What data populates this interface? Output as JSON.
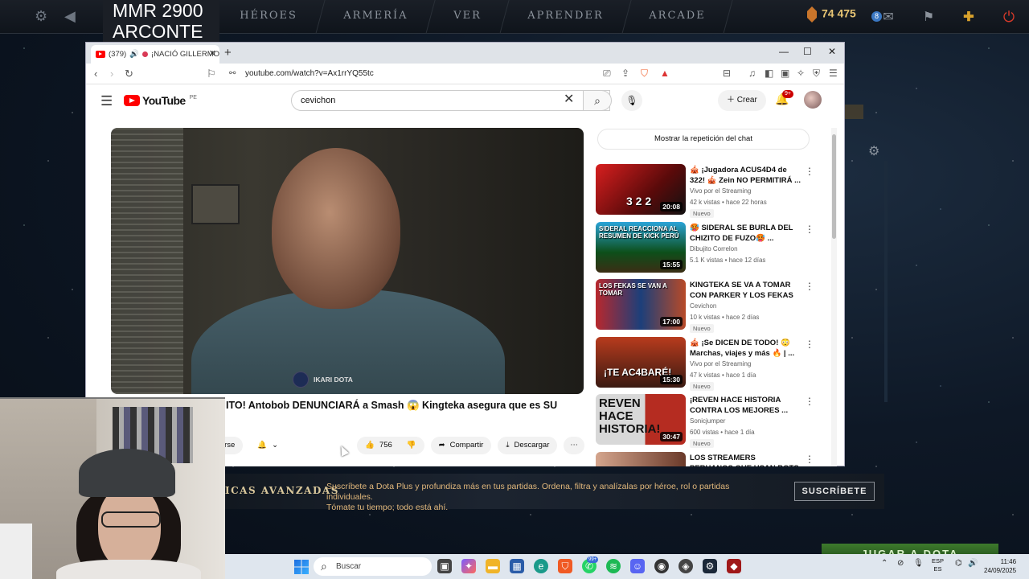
{
  "game": {
    "mmr_line1": "MMR 2900",
    "mmr_line2": "ARCONTE",
    "nav": [
      "HÉROES",
      "ARMERÍA",
      "VER",
      "APRENDER",
      "ARCADE"
    ],
    "shards": "74 475",
    "notif_count": "8",
    "banner": {
      "title": "ICAS AVANZADAS",
      "desc_line1": "Suscríbete a Dota Plus y profundiza más en tus partidas. Ordena, filtra y analízalas por héroe, rol o partidas individuales.",
      "desc_line2": "Tómate tu tiempo; todo está ahí.",
      "cta": "SUSCRÍBETE"
    },
    "play_button": "JUGAR A DOTA"
  },
  "browser": {
    "tab_count": "(379)",
    "tab_title": "¡NACIÓ GILLERMO...",
    "url": "youtube.com/watch?v=Ax1rrYQ55tc"
  },
  "youtube": {
    "logo_text": "YouTube",
    "country": "PE",
    "search_value": "cevichon",
    "create_label": "Crear",
    "notif_badge": "9+",
    "video_title": "ITO! Antobob DENUNCIARÁ a Smash 😱 Kingteka asegura que es SU",
    "watermark": "IKARI DOTA",
    "subscribe_partial": "irse",
    "like_count": "756",
    "share_label": "Compartir",
    "download_label": "Descargar",
    "chat_replay": "Mostrar la repetición del chat",
    "recommendations": [
      {
        "title": "🎪 ¡Jugadora ACUS4D4 de 322! 🎪 Zein NO PERMITIRÁ ...",
        "channel": "Vivo por el Streaming",
        "meta": "42 k vistas • hace 22 horas",
        "badge": "Nuevo",
        "duration": "20:08",
        "thumb_text": "3 2 2"
      },
      {
        "title": "🥵 SIDERAL SE BURLA DEL CHIZITO DE FUZO🥵 ...",
        "channel": "Dibujito Correlon",
        "meta": "5.1 K vistas • hace 12 días",
        "badge": "",
        "duration": "15:55",
        "thumb_text": "SIDERAL REACCIONA AL RESUMEN DE KICK PERÚ"
      },
      {
        "title": "KINGTEKA SE VA A TOMAR CON PARKER Y LOS FEKAS🔥 ...",
        "channel": "Cevichon",
        "meta": "10 k vistas • hace 2 días",
        "badge": "Nuevo",
        "duration": "17:00",
        "thumb_text": "LOS FEKAS SE VAN A TOMAR"
      },
      {
        "title": "🎪 ¡Se DICEN DE TODO! 😳 Marchas, viajes y más 🔥 | ...",
        "channel": "Vivo por el Streaming",
        "meta": "47 k vistas • hace 1 día",
        "badge": "Nuevo",
        "duration": "15:30",
        "thumb_text": "¡TE AC4BARÉ!"
      },
      {
        "title": "¡REVEN HACE HISTORIA CONTRA LOS MEJORES ...",
        "channel": "Sonicjumper",
        "meta": "600 vistas • hace 1 día",
        "badge": "Nuevo",
        "duration": "30:47",
        "thumb_text": "REVEN HACE HISTORIA!"
      },
      {
        "title": "LOS STREAMERS PERUANOS QUE USAN BOTS 🔥 FANORBI ...",
        "channel": "",
        "meta": "",
        "badge": "",
        "duration": "",
        "thumb_text": ""
      }
    ]
  },
  "taskbar": {
    "search_placeholder": "Buscar",
    "lang_top": "ESP",
    "lang_bottom": "ES",
    "time": "11:46",
    "date": "24/09/2025",
    "badge_whatsapp": "99+"
  }
}
